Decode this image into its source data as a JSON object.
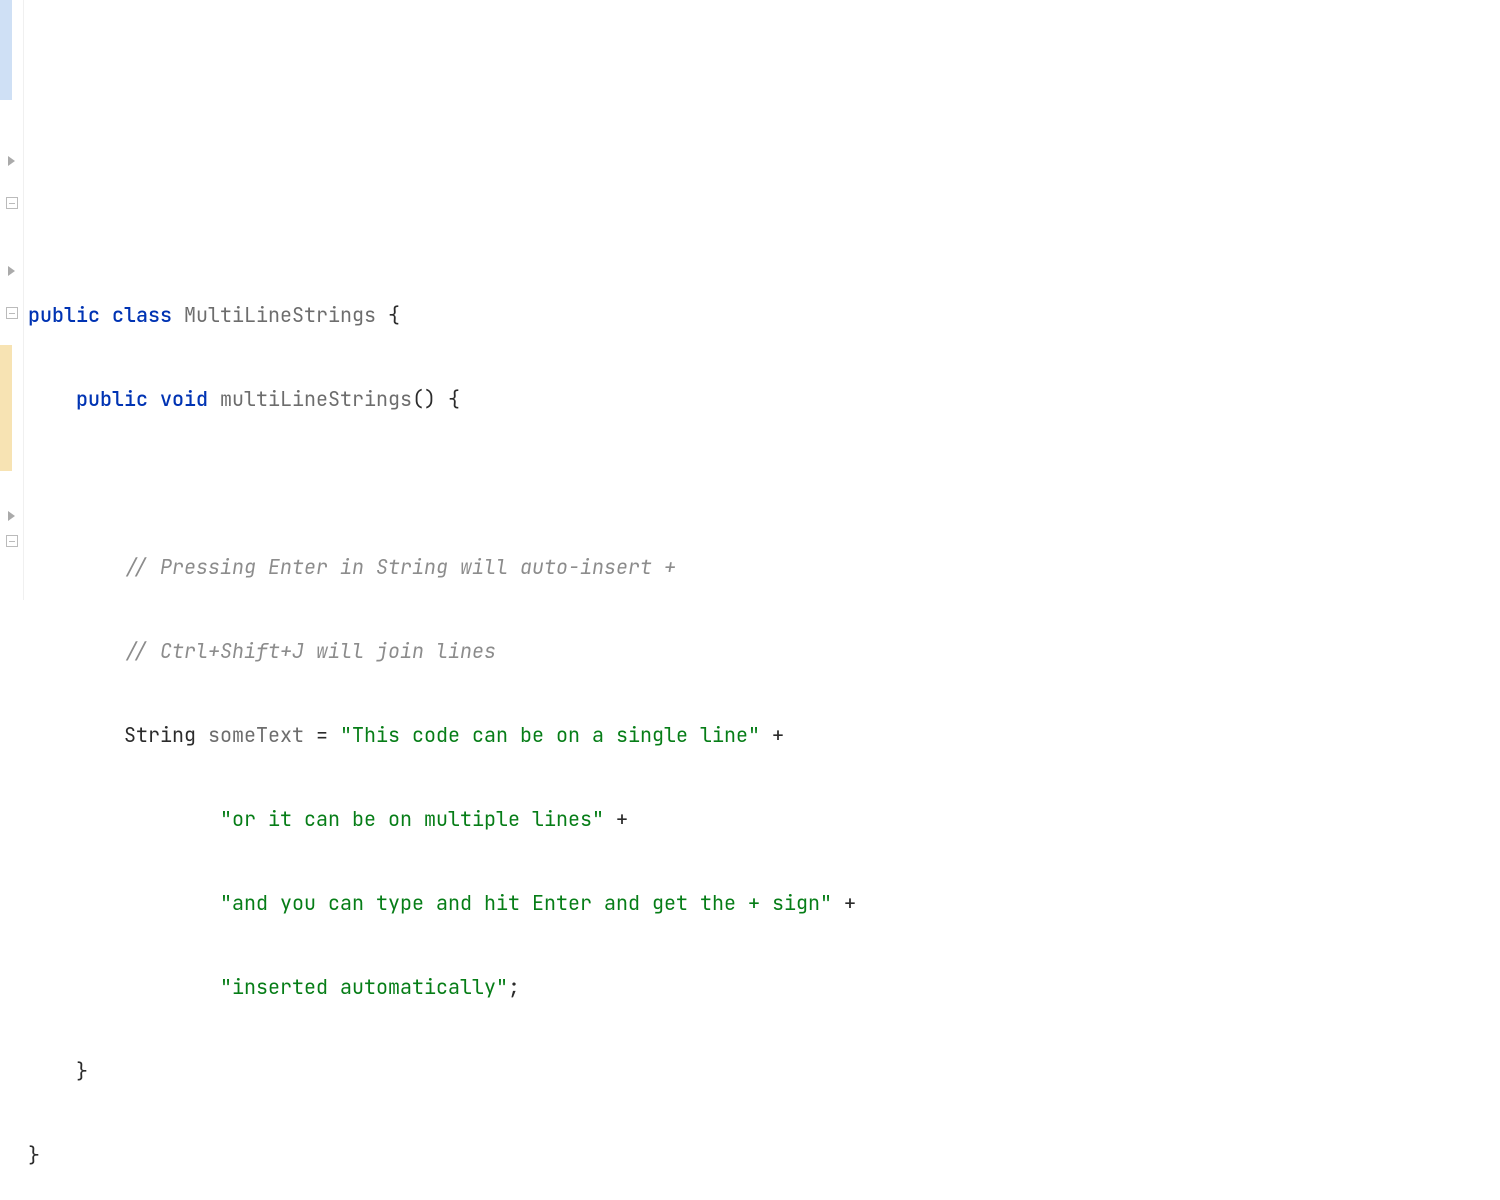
{
  "code": {
    "line1_kw1": "public",
    "line1_kw2": "class",
    "line1_cls": "MultiLineStrings",
    "line1_brace": " {",
    "line2_kw1": "public",
    "line2_kw2": "void",
    "line2_mtd": "multiLineStrings",
    "line2_paren": "() {",
    "comment1": "// Pressing Enter in String will auto-insert +",
    "comment2": "// Ctrl+Shift+J will join lines",
    "line5_typ": "String",
    "line5_var": "someText",
    "line5_eq": " = ",
    "str1": "\"This code can be on a single line\"",
    "plus": " +",
    "str2": "\"or it can be on multiple lines\"",
    "str3": "\"and you can type and hit Enter and get the + sign\"",
    "str4": "\"inserted automatically\"",
    "semi": ";",
    "rbrace": "}"
  }
}
